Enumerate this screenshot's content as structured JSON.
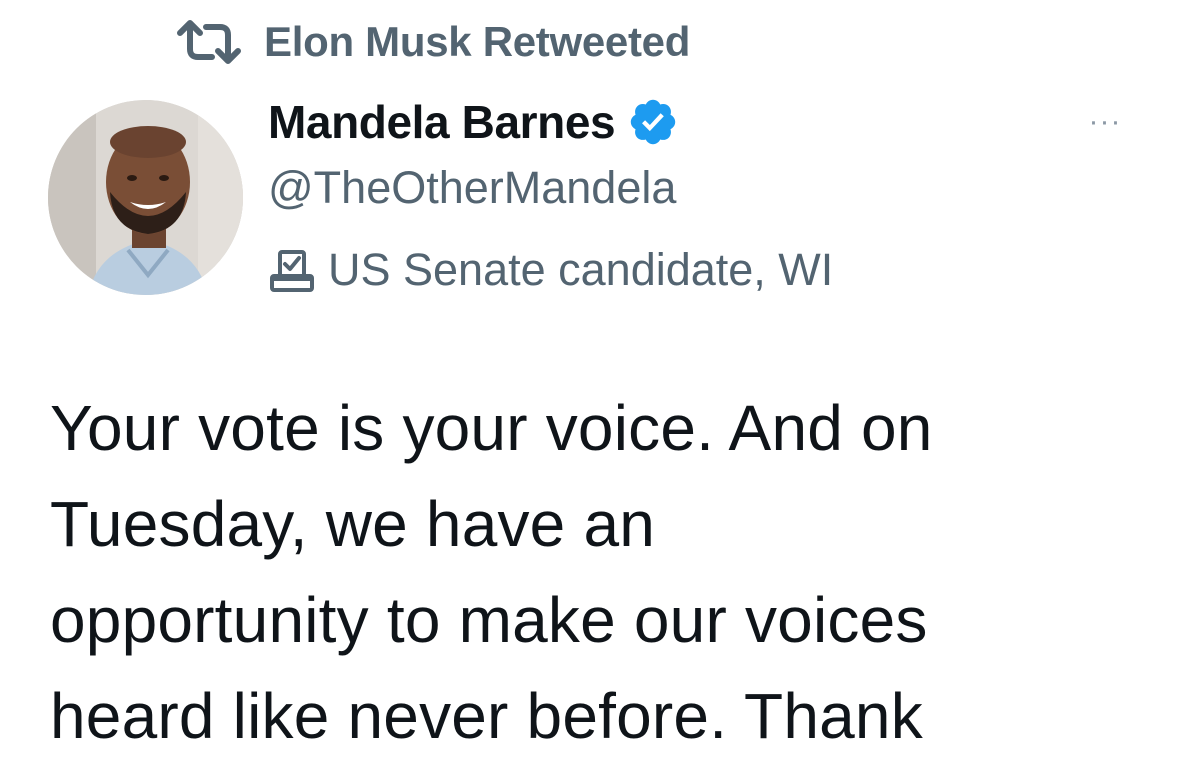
{
  "retweet": {
    "icon": "retweet-icon",
    "label": "Elon Musk Retweeted"
  },
  "author": {
    "avatar": "avatar",
    "name": "Mandela Barnes",
    "verified_icon": "verified-badge-icon",
    "verified_color": "#1d9bf0",
    "handle": "@TheOtherMandela",
    "bio_icon": "ballot-box-icon",
    "bio": "US Senate candidate, WI"
  },
  "more_button": {
    "icon": "more-options-icon",
    "label": "···"
  },
  "tweet": {
    "lines": [
      "Your vote is your voice. And on",
      "Tuesday, we have an",
      "opportunity to make our voices",
      "heard like never before. Thank"
    ]
  },
  "colors": {
    "text_primary": "#0f1419",
    "text_secondary": "#536471",
    "accent": "#1d9bf0"
  }
}
